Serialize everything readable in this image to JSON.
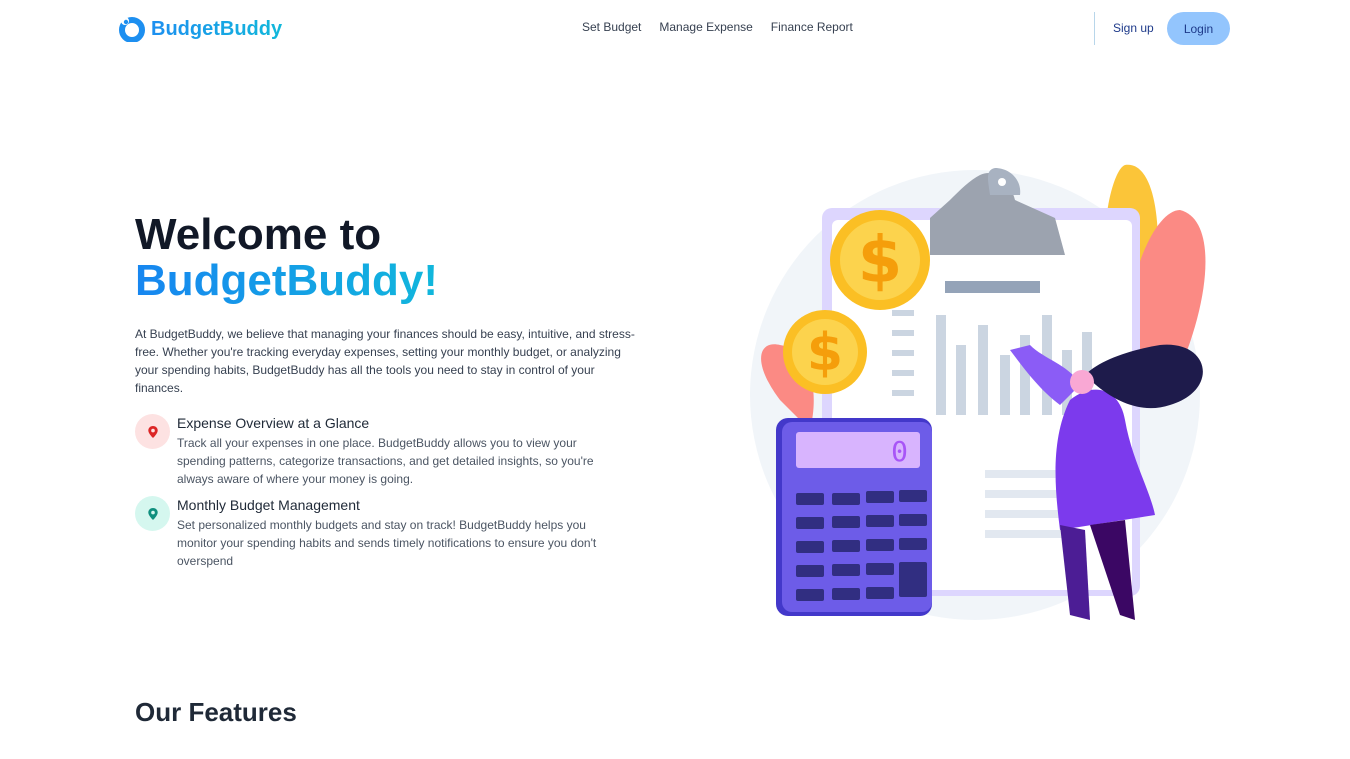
{
  "nav": {
    "brand": "BudgetBuddy",
    "links": [
      "Set Budget",
      "Manage Expense",
      "Finance Report"
    ],
    "signup": "Sign up",
    "login": "Login"
  },
  "hero": {
    "title_line1": "Welcome to",
    "title_line2": "BudgetBuddy!",
    "description": "At BudgetBuddy, we believe that managing your finances should be easy, intuitive, and stress-free. Whether you're tracking everyday expenses, setting your monthly budget, or analyzing your spending habits, BudgetBuddy has all the tools you need to stay in control of your finances.",
    "features": [
      {
        "title": "Expense Overview at a Glance",
        "text": "Track all your expenses in one place. BudgetBuddy allows you to view your spending patterns, categorize transactions, and get detailed insights, so you're always aware of where your money is going.",
        "icon": "map-pin-icon",
        "color": "#dc2626",
        "badge_bg": "#fde2e2"
      },
      {
        "title": "Monthly Budget Management",
        "text": "Set personalized monthly budgets and stay on track! BudgetBuddy helps you monitor your spending habits and sends timely notifications to ensure you don't overspend",
        "icon": "map-pin-icon",
        "color": "#0f8f7e",
        "badge_bg": "#d5f7ef"
      }
    ],
    "calculator_display": "0"
  },
  "features_section": {
    "title": "Our Features"
  },
  "colors": {
    "brand_blue": "#1d8ff0",
    "brand_cyan": "#12b8da",
    "login_bg": "#93c5fd"
  }
}
